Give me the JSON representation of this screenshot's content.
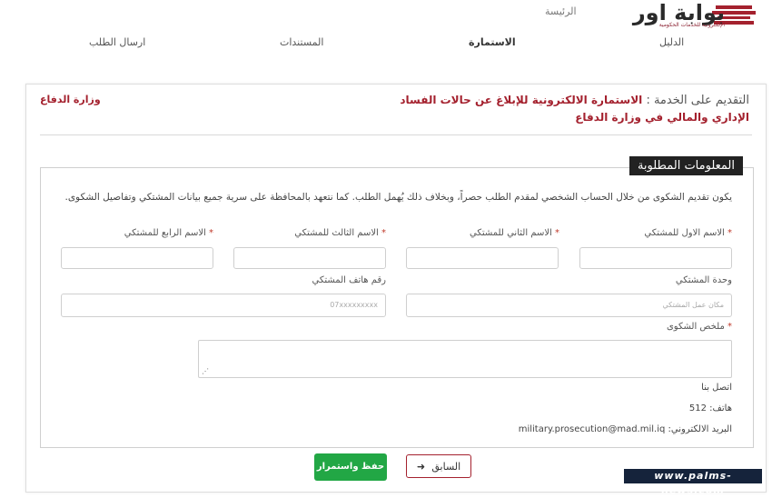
{
  "header": {
    "logo_text": "بوابة اور",
    "logo_subtitle": "الإلكترونية للخدمات الحكومية",
    "home_link": "الرئيسة",
    "steps": [
      "الدليل",
      "الاستمارة",
      "المستندات",
      "ارسال الطلب"
    ],
    "active_step": "الاستمارة"
  },
  "service": {
    "lead": "التقديم على الخدمة :",
    "name": "الاستمارة الالكترونية للإبلاغ عن حالات الفساد الإداري والمالي في وزارة الدفاع",
    "ministry": "وزارة الدفاع"
  },
  "form": {
    "legend": "المعلومات المطلوبة",
    "intro": "يكون تقديم الشكوى من خلال الحساب الشخصي لمقدم الطلب حصراً، وبخلاف ذلك يُهمل الطلب. كما نتعهد بالمحافظة على سرية جميع بيانات المشتكي وتفاصيل الشكوى.",
    "required_mark": "*",
    "fields": {
      "first_name": "الاسم الاول للمشتكي",
      "second_name": "الاسم الثاني للمشتكي",
      "third_name": "الاسم الثالث للمشتكي",
      "fourth_name": "الاسم الرابع للمشتكي",
      "unit": "وحدة المشتكي",
      "unit_placeholder": "مكان عمل المشتكي",
      "phone": "رقم هاتف المشتكي",
      "phone_placeholder": "07xxxxxxxxx",
      "summary": "ملخص الشكوى"
    },
    "contact": {
      "title": "اتصل بنا",
      "phone": "هاتف: 512",
      "email": "البريد الالكتروني: military.prosecution@mad.mil.iq"
    }
  },
  "buttons": {
    "save": "حفظ واستمرار",
    "previous": "السابق"
  },
  "watermark": "www.palms-news.com",
  "colors": {
    "brand": "#a4212e",
    "save_button": "#22a745",
    "legend_bg": "#222222"
  }
}
